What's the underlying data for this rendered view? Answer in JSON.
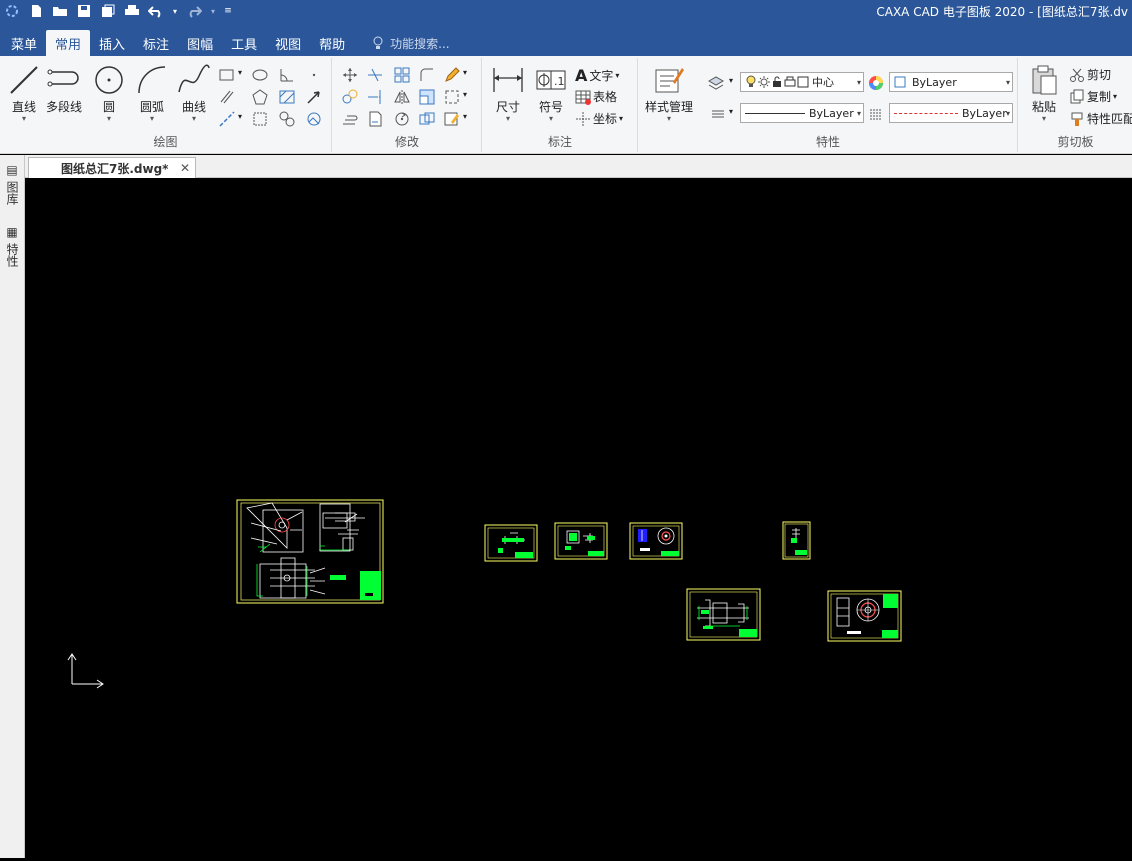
{
  "window": {
    "title": "CAXA CAD 电子图板 2020 - [图纸总汇7张.dv"
  },
  "menu": {
    "tabs": [
      {
        "label": "菜单"
      },
      {
        "label": "常用"
      },
      {
        "label": "插入"
      },
      {
        "label": "标注"
      },
      {
        "label": "图幅"
      },
      {
        "label": "工具"
      },
      {
        "label": "视图"
      },
      {
        "label": "帮助"
      }
    ],
    "active_index": 1,
    "search_label": "功能搜索..."
  },
  "ribbon": {
    "draw": {
      "label": "绘图",
      "line": "直线",
      "polyline": "多段线",
      "circle": "圆",
      "arc": "圆弧",
      "curve": "曲线"
    },
    "modify": {
      "label": "修改"
    },
    "annotate": {
      "label": "标注",
      "dimension": "尺寸",
      "symbol": "符号",
      "text": "文字",
      "table": "表格",
      "coordinate": "坐标"
    },
    "properties": {
      "label": "特性",
      "style_manager": "样式管理",
      "layer_value": "中心",
      "color_value": "ByLayer",
      "linetype_value": "ByLayer",
      "lineweight_value": "ByLayer"
    },
    "clipboard": {
      "label": "剪切板",
      "paste": "粘贴",
      "cut": "剪切",
      "copy": "复制",
      "match": "特性匹配"
    }
  },
  "document": {
    "tab_label": "图纸总汇7张.dwg*"
  },
  "sidebar": {
    "library_label": "图库",
    "properties_label": "特性"
  },
  "colors": {
    "accent": "#2b579a",
    "frame": "#ffff66",
    "fill": "#00ff33",
    "canvas": "#000000"
  }
}
